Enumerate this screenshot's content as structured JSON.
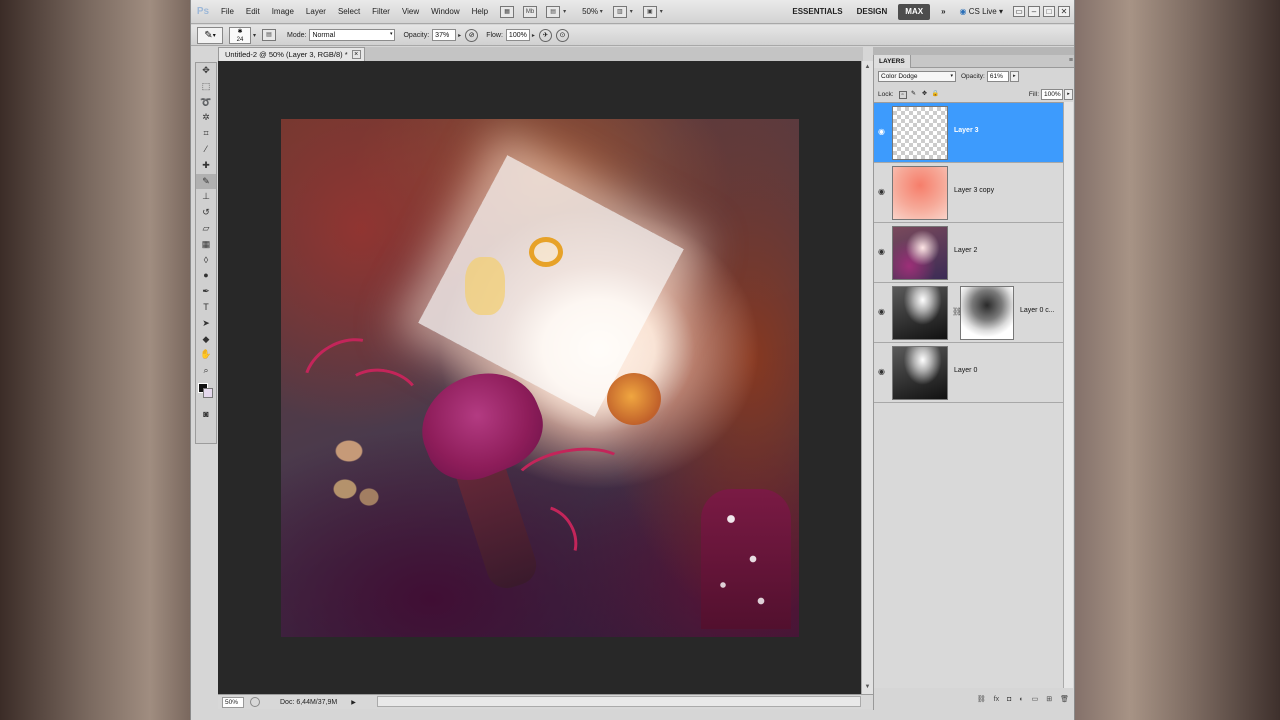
{
  "app": {
    "logo": "Ps"
  },
  "menu": [
    "File",
    "Edit",
    "Image",
    "Layer",
    "Select",
    "Filter",
    "View",
    "Window",
    "Help"
  ],
  "menubar": {
    "mb_label": "Mb",
    "zoom": "50%",
    "workspaces": [
      "ESSENTIALS",
      "DESIGN",
      "MAX"
    ],
    "active_workspace": "MAX",
    "overflow": "»",
    "cs_live": "CS Live"
  },
  "options": {
    "brush_size": "24",
    "mode_label": "Mode:",
    "mode_value": "Normal",
    "opacity_label": "Opacity:",
    "opacity_value": "37%",
    "flow_label": "Flow:",
    "flow_value": "100%"
  },
  "document": {
    "tab_title": "Untitled-2 @ 50% (Layer 3, RGB/8) *",
    "status_zoom": "50%",
    "status_doc": "Doc: 6,44M/37,9M"
  },
  "layers_panel": {
    "tab": "LAYERS",
    "blend_mode": "Color Dodge",
    "opacity_label": "Opacity:",
    "opacity_value": "61%",
    "lock_label": "Lock:",
    "fill_label": "Fill:",
    "fill_value": "100%",
    "layers": [
      {
        "name": "Layer 3",
        "selected": true,
        "thumb": "checker"
      },
      {
        "name": "Layer 3 copy",
        "selected": false,
        "thumb": "salmon"
      },
      {
        "name": "Layer 2",
        "selected": false,
        "thumb": "painting"
      },
      {
        "name": "Layer 0 c...",
        "selected": false,
        "thumb": "dark",
        "has_mask": true
      },
      {
        "name": "Layer 0",
        "selected": false,
        "thumb": "dark"
      }
    ]
  },
  "colors": {
    "selection_blue": "#3d9bfd",
    "pasteboard": "#282828",
    "active_workspace_bg": "#4d4d4d"
  }
}
